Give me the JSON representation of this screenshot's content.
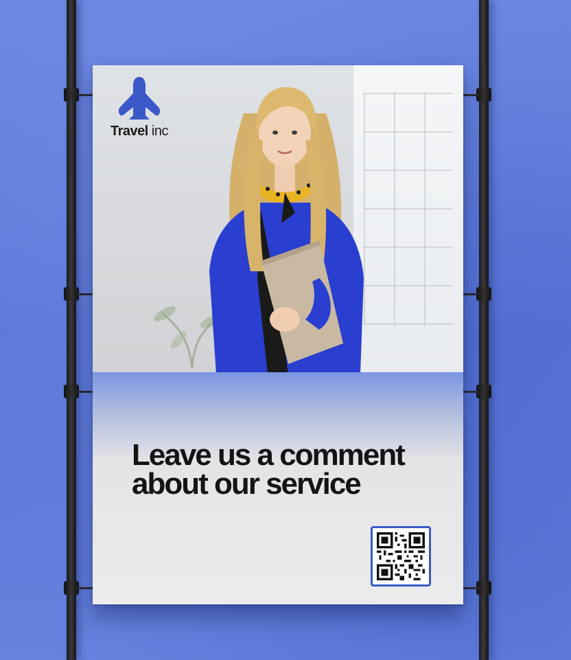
{
  "poster": {
    "brand": {
      "name_bold": "Travel",
      "name_light": "inc",
      "logo_icon": "airplane-logo-icon",
      "brand_color": "#3a58c7"
    },
    "headline": {
      "line1": "Leave us a comment",
      "line2": "about our service"
    },
    "qr_code": {
      "icon": "qr-code-icon",
      "border_color": "#3a58c7"
    }
  },
  "scene": {
    "background_color": "#5c79d8",
    "pole_color": "#1e1e20"
  }
}
